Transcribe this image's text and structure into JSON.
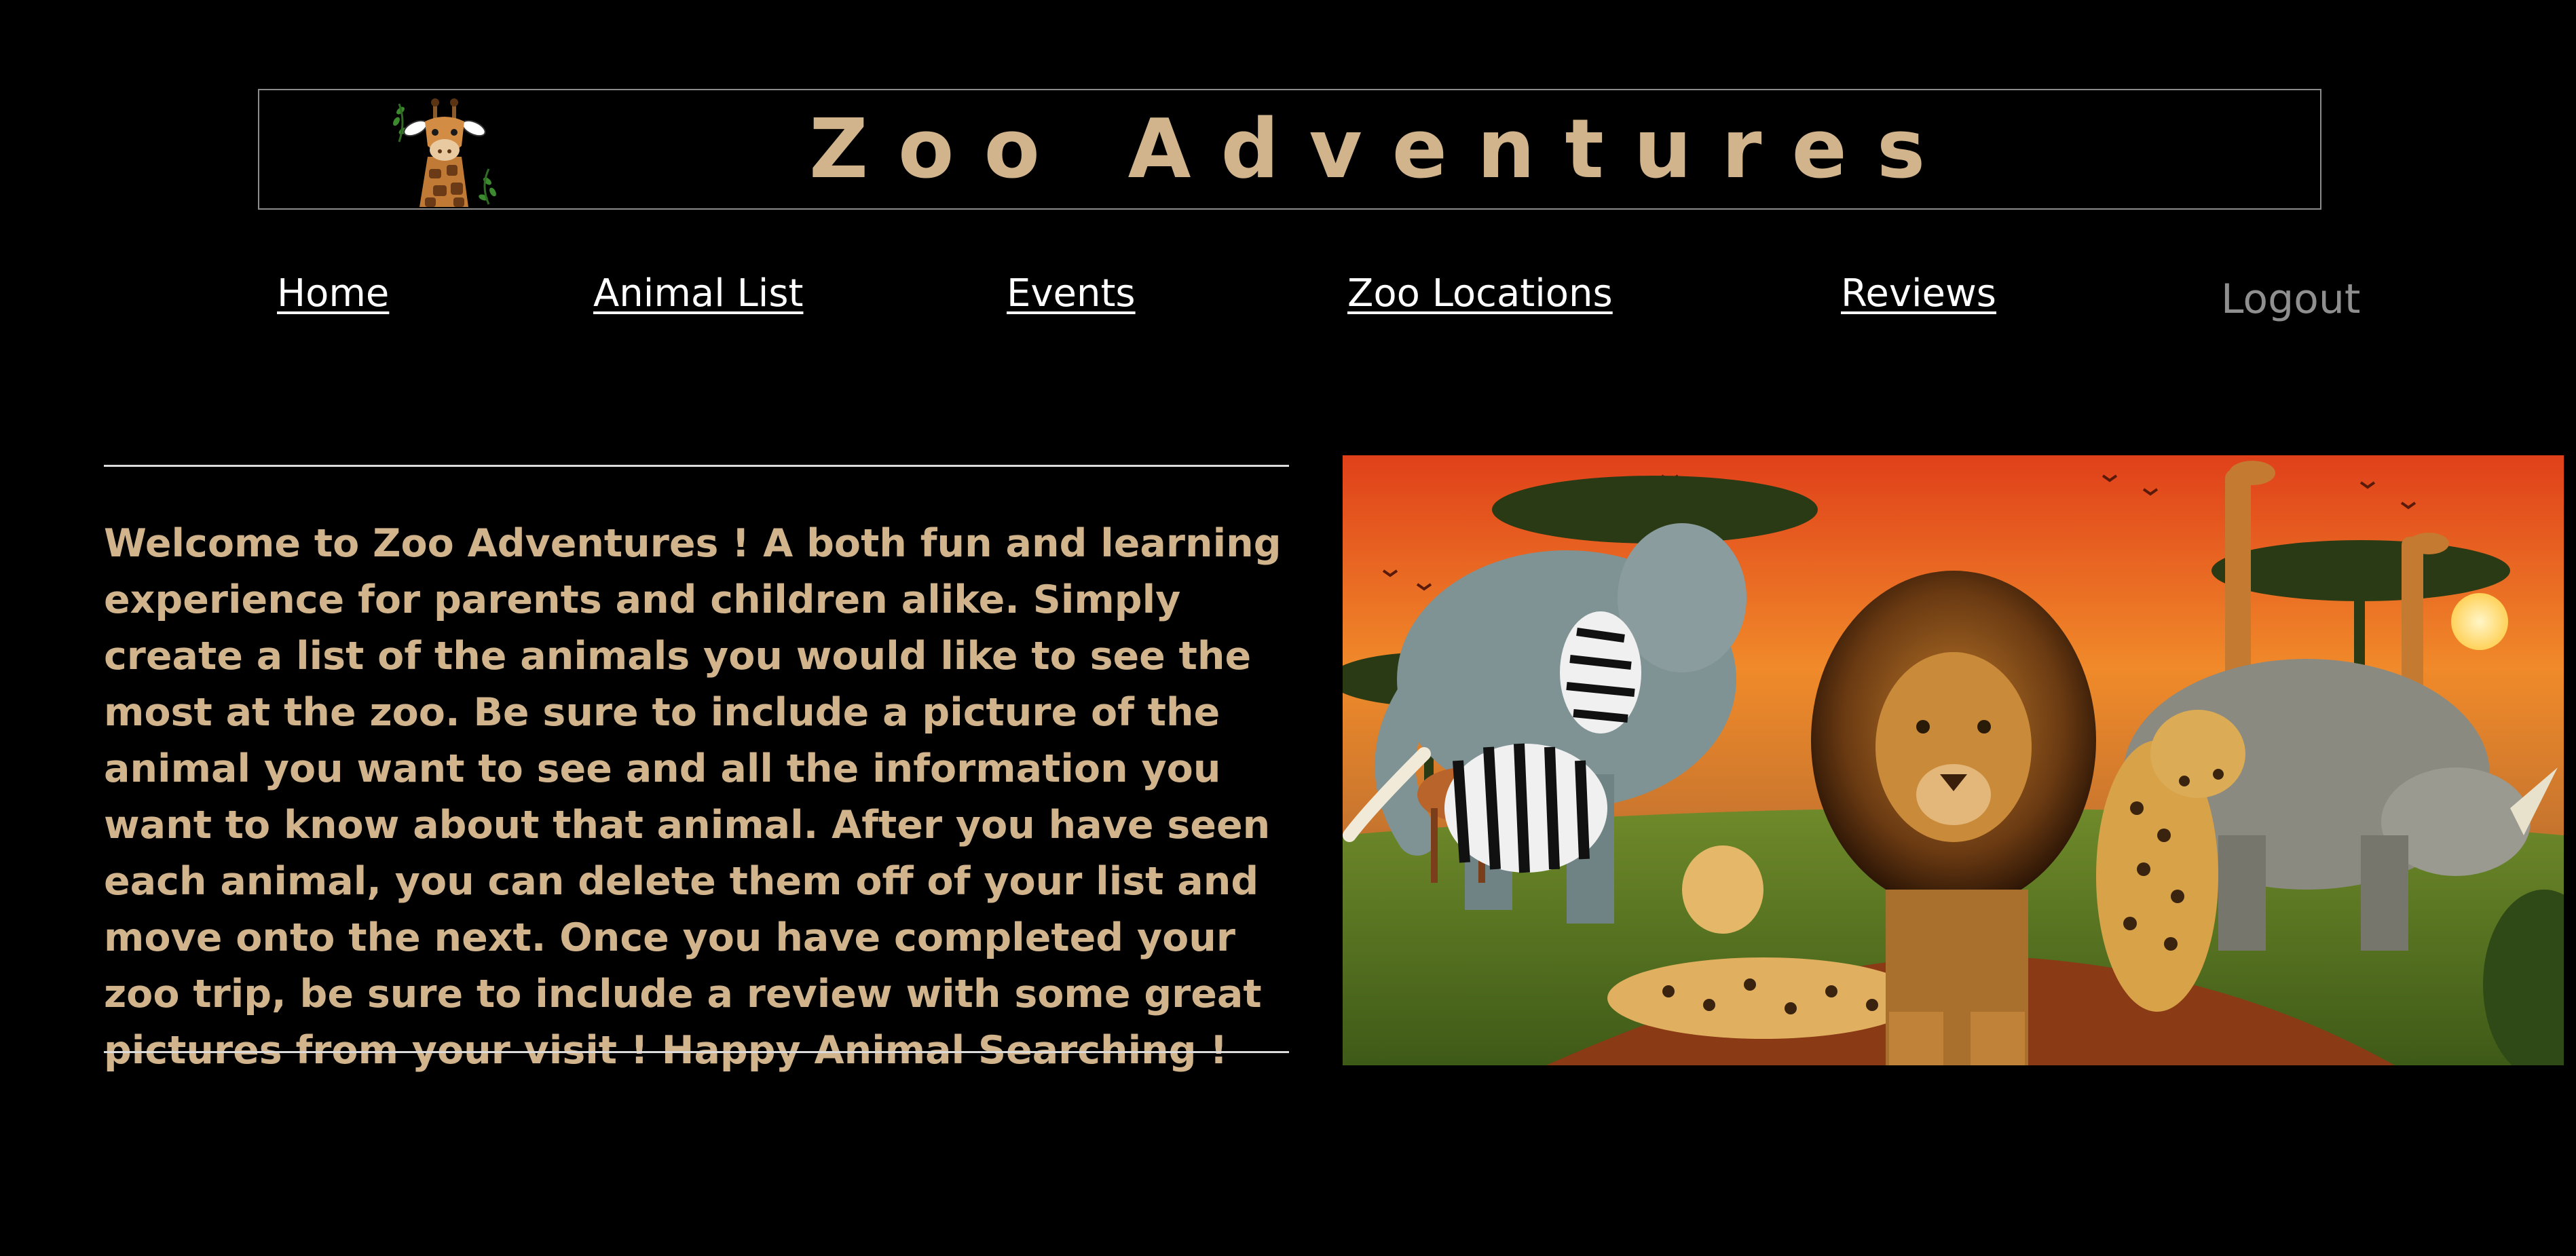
{
  "header": {
    "title": "Zoo Adventures",
    "logo_icon": "giraffe-icon"
  },
  "nav": {
    "items": [
      {
        "label": "Home"
      },
      {
        "label": "Animal List"
      },
      {
        "label": "Events"
      },
      {
        "label": "Zoo Locations"
      },
      {
        "label": "Reviews"
      }
    ],
    "logout_label": "Logout"
  },
  "main": {
    "welcome_text": "Welcome to Zoo Adventures ! A both fun and learning experience for parents and children alike. Simply create a list of the animals you would like to see the most at the zoo. Be sure to include a picture of the animal you want to see and all the information you want to know about that animal. After you have seen each animal, you can delete them off of your list and move onto the next. Once you have completed your zoo trip, be sure to include a review with some great pictures from your visit ! Happy Animal Searching !",
    "hero_image": "safari-animals-illustration"
  },
  "colors": {
    "background": "#000000",
    "accent_tan": "#d2b48c",
    "nav_link": "#ffffff",
    "logout_gray": "#8f8f8f"
  }
}
